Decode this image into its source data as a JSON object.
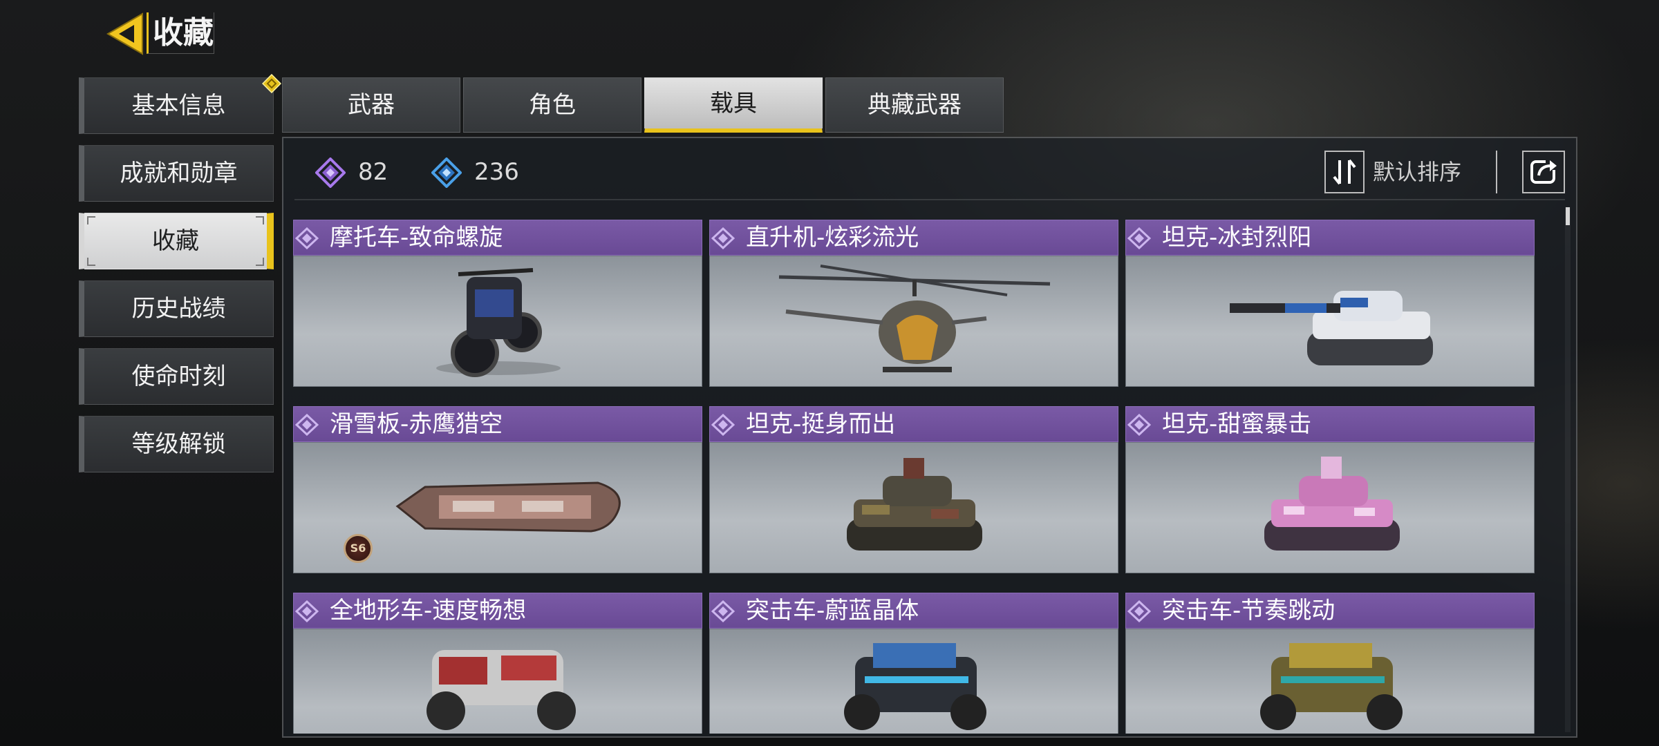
{
  "header": {
    "title": "收藏",
    "back_icon": "back-arrow-icon"
  },
  "sidebar": {
    "items": [
      {
        "label": "基本信息",
        "has_badge": true
      },
      {
        "label": "成就和勋章"
      },
      {
        "label": "收藏",
        "active": true
      },
      {
        "label": "历史战绩"
      },
      {
        "label": "使命时刻"
      },
      {
        "label": "等级解锁"
      }
    ]
  },
  "tabs": [
    {
      "label": "武器"
    },
    {
      "label": "角色"
    },
    {
      "label": "载具",
      "active": true
    },
    {
      "label": "典藏武器"
    }
  ],
  "counts": {
    "purple": {
      "value": "82",
      "color": "#9b6ee0"
    },
    "blue": {
      "value": "236",
      "color": "#3f8fd6"
    }
  },
  "sort": {
    "label": "默认排序"
  },
  "cards": [
    {
      "name": "摩托车-致命螺旋",
      "vehicle": "motorcycle"
    },
    {
      "name": "直升机-炫彩流光",
      "vehicle": "helicopter"
    },
    {
      "name": "坦克-冰封烈阳",
      "vehicle": "tank-white-blue"
    },
    {
      "name": "滑雪板-赤鹰猎空",
      "vehicle": "snowboard",
      "season_badge": "S6"
    },
    {
      "name": "坦克-挺身而出",
      "vehicle": "tank-camo"
    },
    {
      "name": "坦克-甜蜜暴击",
      "vehicle": "tank-pink"
    },
    {
      "name": "全地形车-速度畅想",
      "vehicle": "atv"
    },
    {
      "name": "突击车-蔚蓝晶体",
      "vehicle": "assault-car-blue"
    },
    {
      "name": "突击车-节奏跳动",
      "vehicle": "assault-car-gold"
    }
  ],
  "colors": {
    "accent": "#e9c31c",
    "card_header": "#6f4f9c"
  }
}
